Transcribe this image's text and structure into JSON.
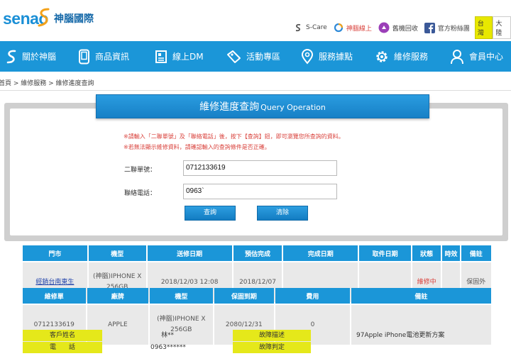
{
  "header": {
    "logo_en": "senao",
    "logo_cn": "神腦國際",
    "links": [
      {
        "label": "S-Care",
        "icon": "s-care-icon",
        "color": "#4a4a4a"
      },
      {
        "label": "神腦線上",
        "icon": "senao-online-icon",
        "color": "#d9413b"
      },
      {
        "label": "舊機回收",
        "icon": "recycle-icon",
        "color": "#8a3aa8"
      },
      {
        "label": "官方粉絲團",
        "icon": "facebook-icon",
        "color": "#3b5998"
      }
    ],
    "regions": [
      "台灣",
      "大陸"
    ]
  },
  "nav": [
    {
      "label": "關於神腦",
      "icon": "senao-s-icon"
    },
    {
      "label": "商品資訊",
      "icon": "phone-icon"
    },
    {
      "label": "線上DM",
      "icon": "dm-icon"
    },
    {
      "label": "活動專區",
      "icon": "ticket-icon"
    },
    {
      "label": "服務據點",
      "icon": "location-pin-icon"
    },
    {
      "label": "維修服務",
      "icon": "gear-icon"
    },
    {
      "label": "會員中心",
      "icon": "user-icon"
    }
  ],
  "breadcrumb": "首頁 > 維修服務 > 維修進度查詢",
  "panel": {
    "title_cn": "維修進度查詢",
    "title_en": "Query Operation",
    "note1": "※請輸入「二聯單號」及「聯絡電話」後，按下【查詢】鈕，即可瀏覽您所查詢的資料。",
    "note2": "※若無法顯示維修資料，請確認輸入的查詢條件是否正確。",
    "order_label": "二聯單號：",
    "order_value": "0712133619",
    "phone_label": "聯絡電話：",
    "phone_value": "0963`",
    "query_button": "查詢",
    "clear_button": "清除"
  },
  "table1": {
    "headers": [
      "門市",
      "機型",
      "送修日期",
      "預估完成",
      "完成日期",
      "取件日期",
      "狀態",
      "時效",
      "備註"
    ],
    "row": [
      "經銷台南東生",
      "(神腦)IPHONE X 256GB",
      "2018/12/03 12:08",
      "2018/12/07",
      "",
      "",
      "維修中",
      "",
      "保固外"
    ]
  },
  "table2": {
    "headers": [
      "維修單",
      "廠牌",
      "機型",
      "保固到期",
      "費用",
      "備註"
    ],
    "row": [
      "0712133619",
      "APPLE",
      "(神腦)IPHONE X 256GB",
      "2080/12/31",
      "0",
      ""
    ]
  },
  "info": {
    "customer_label": "客戶姓名",
    "customer_value": "林**",
    "fault_label": "故障描述",
    "fault_value": "97Apple iPhone電池更新方案",
    "phone_label": "電　　話",
    "phone_value": "0963******",
    "judge_label": "故障判定",
    "judge_value": ""
  }
}
